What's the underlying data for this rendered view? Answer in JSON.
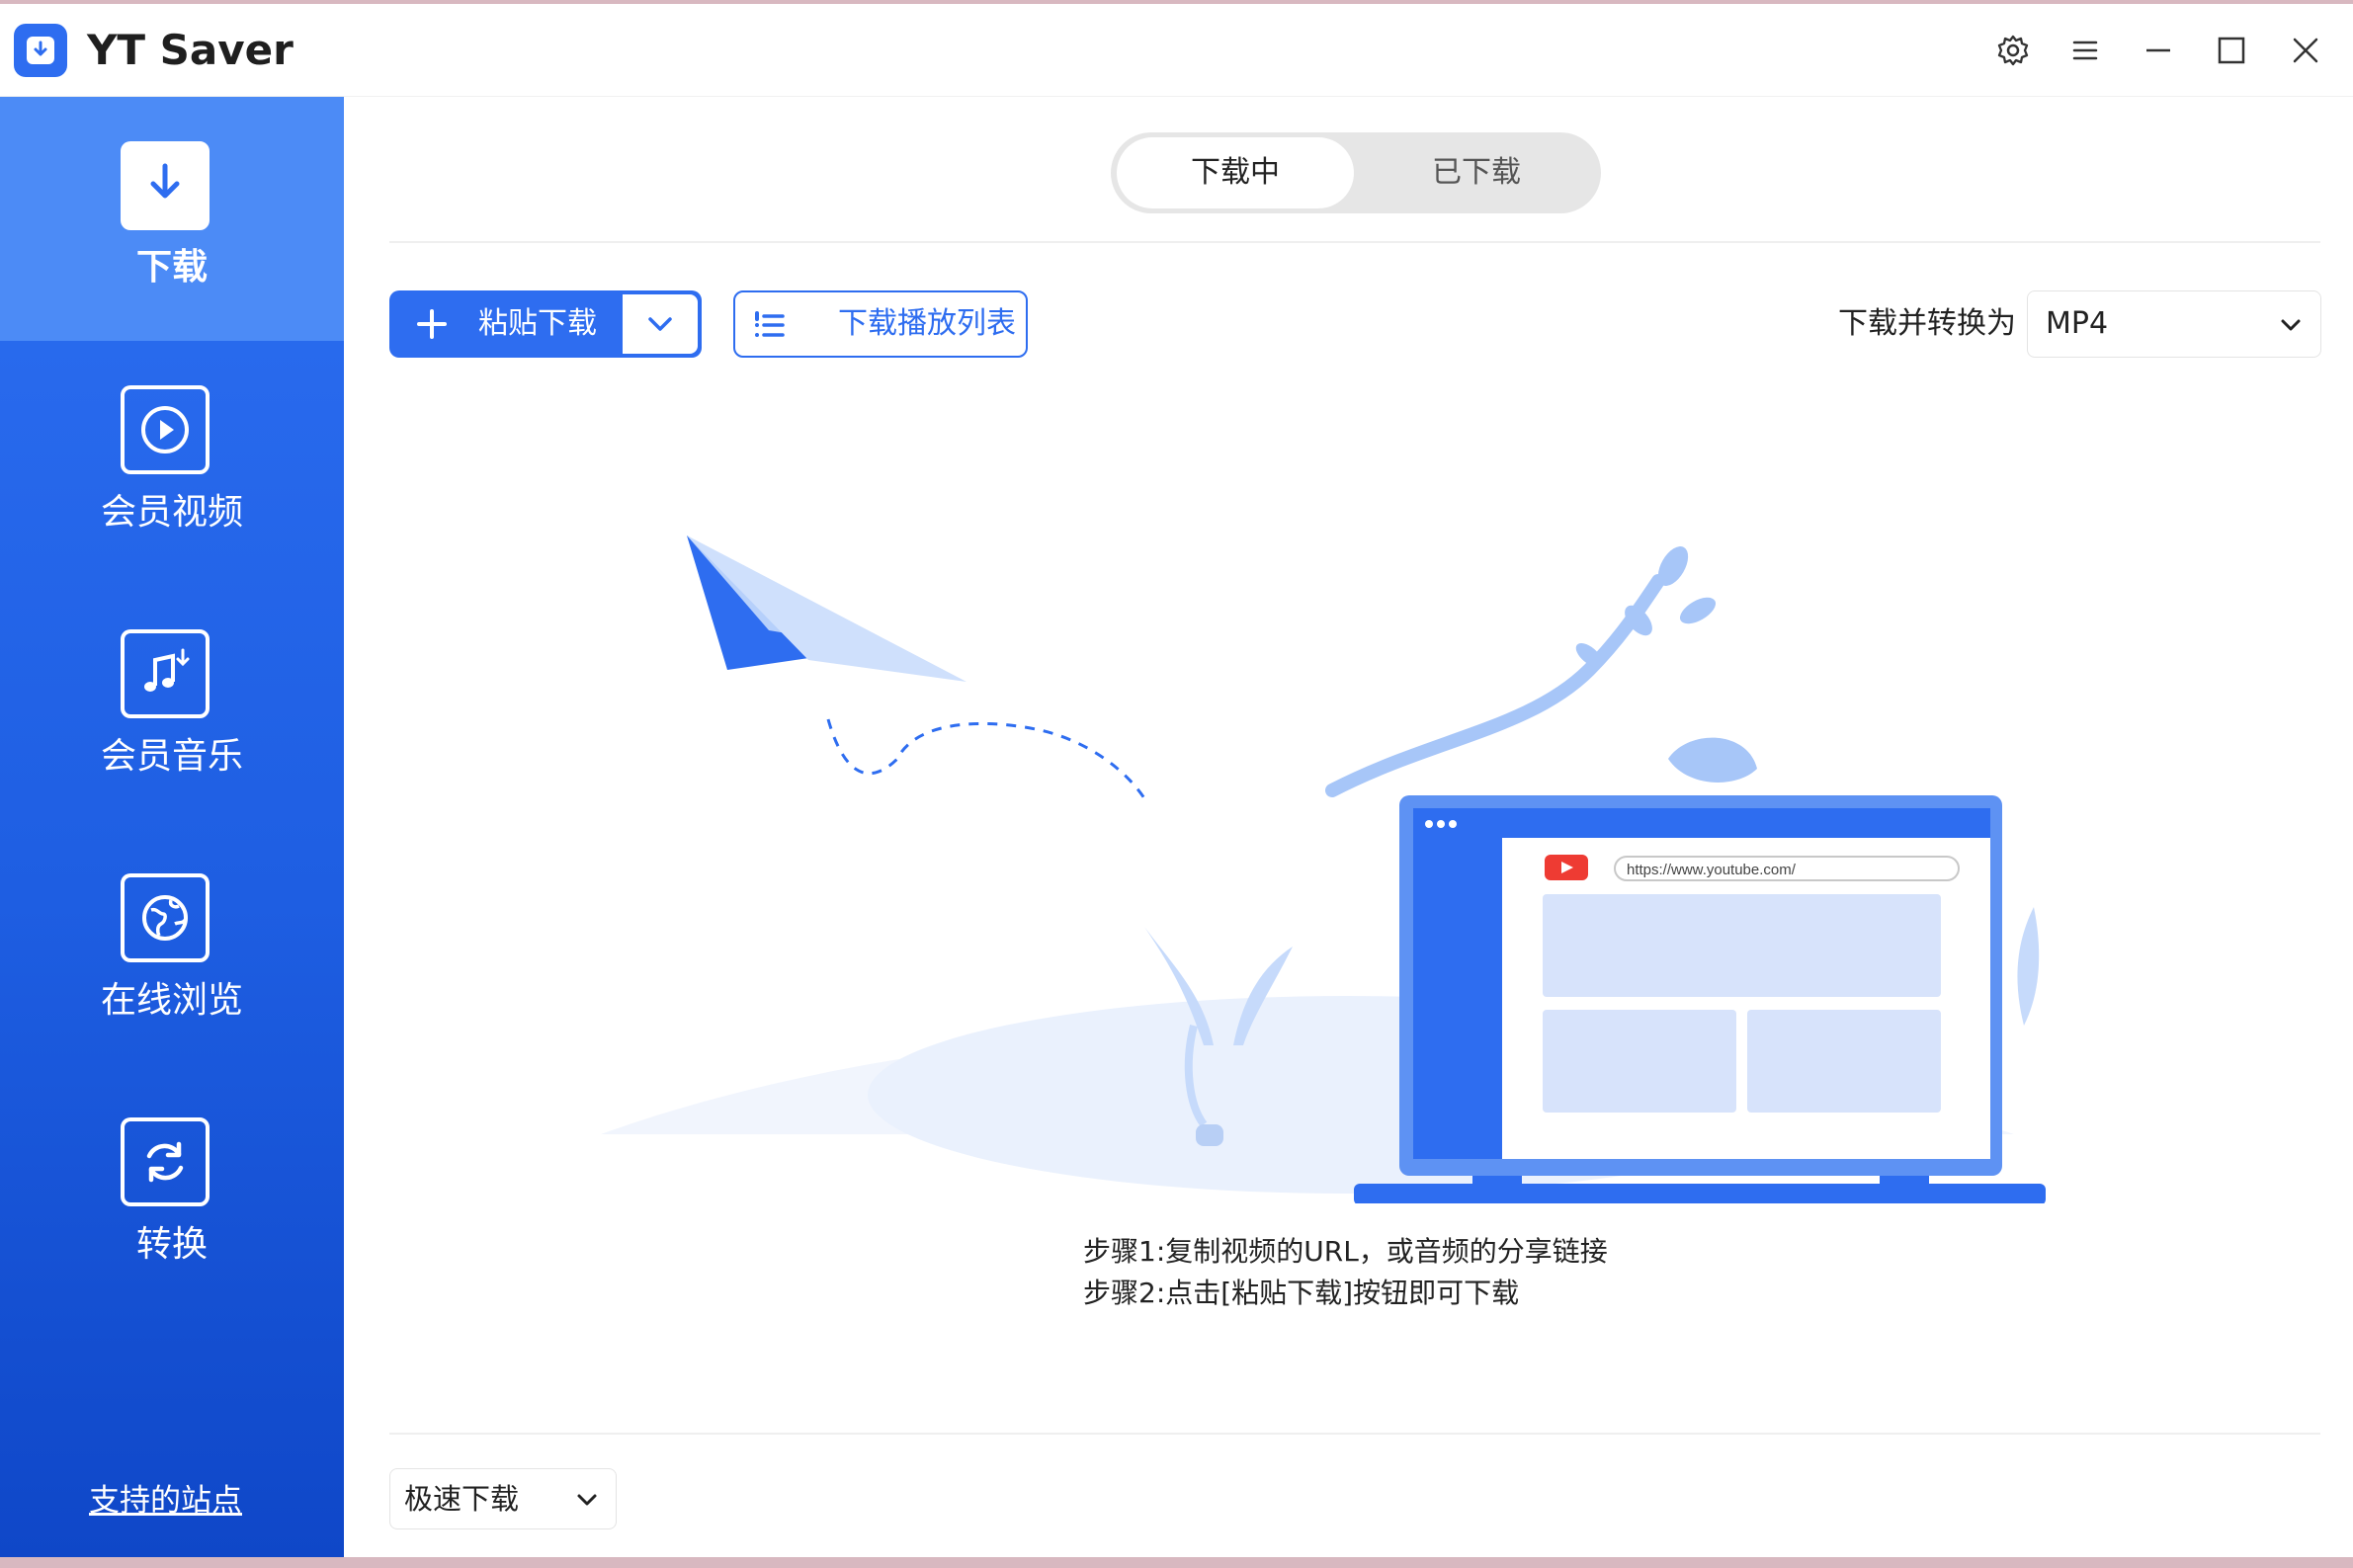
{
  "app": {
    "title": "YT Saver"
  },
  "sidebar": {
    "items": [
      {
        "label": "下载",
        "icon": "download-icon",
        "active": true
      },
      {
        "label": "会员视频",
        "icon": "play-circle-icon"
      },
      {
        "label": "会员音乐",
        "icon": "music-note-icon"
      },
      {
        "label": "在线浏览",
        "icon": "globe-icon"
      },
      {
        "label": "转换",
        "icon": "refresh-icon"
      }
    ],
    "supported_sites": "支持的站点"
  },
  "tabs": {
    "downloading": "下载中",
    "downloaded": "已下载"
  },
  "toolbar": {
    "paste_download": "粘贴下载",
    "download_playlist": "下载播放列表",
    "convert_label": "下载并转换为",
    "format": "MP4"
  },
  "illustration": {
    "url": "https://www.youtube.com/"
  },
  "steps": {
    "step1": "步骤1:复制视频的URL，或音频的分享链接",
    "step2": "步骤2:点击[粘贴下载]按钮即可下载"
  },
  "footer": {
    "speed_mode": "极速下载"
  },
  "colors": {
    "accent": "#2e6df0",
    "sidebar_active": "#4c8bf6"
  }
}
